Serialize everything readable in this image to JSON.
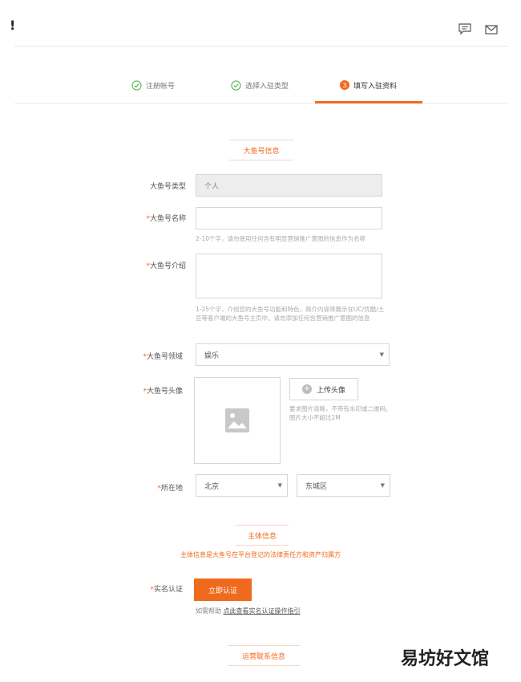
{
  "header": {
    "logo_text": "!",
    "icons": [
      "comment-icon",
      "mail-icon"
    ]
  },
  "steps": [
    {
      "label": "注册帐号",
      "state": "done"
    },
    {
      "label": "选择入驻类型",
      "state": "done"
    },
    {
      "label": "填写入驻资料",
      "state": "active",
      "number": "3"
    }
  ],
  "section_account": {
    "title": "大鱼号信息"
  },
  "form": {
    "type": {
      "label": "大鱼号类型",
      "value": "个人"
    },
    "name": {
      "label": "大鱼号名称",
      "value": "",
      "hint": "2-10个字，请勿使用任何含有明显营销推广意图的信息作为名称"
    },
    "intro": {
      "label": "大鱼号介绍",
      "value": "",
      "hint": "1-25个字，介绍您的大鱼号功能和特色，简介内容将展示在UC/优酷/土豆等客户端的大鱼号主页中。请勿添加任何含营销推广意图的信息"
    },
    "domain": {
      "label": "大鱼号领域",
      "value": "娱乐"
    },
    "avatar": {
      "label": "大鱼号头像",
      "upload_label": "上传头像",
      "hint": "要求图片清晰，不带有水印或二维码。图片大小不超过2M"
    },
    "location": {
      "label": "所在地",
      "province": "北京",
      "district": "东城区"
    }
  },
  "section_entity": {
    "title": "主体信息",
    "subtitle": "主体信息是大鱼号在平台登记的法律责任方和资产归属方"
  },
  "verify": {
    "label": "实名认证",
    "button_label": "立即认证",
    "help_prefix": "如需帮助",
    "help_link": "点此查看实名认证操作指引"
  },
  "section_ops": {
    "title": "运营联系信息"
  },
  "watermark": "易坊好文馆",
  "colors": {
    "accent": "#f06a1d",
    "check": "#5cb85c"
  }
}
